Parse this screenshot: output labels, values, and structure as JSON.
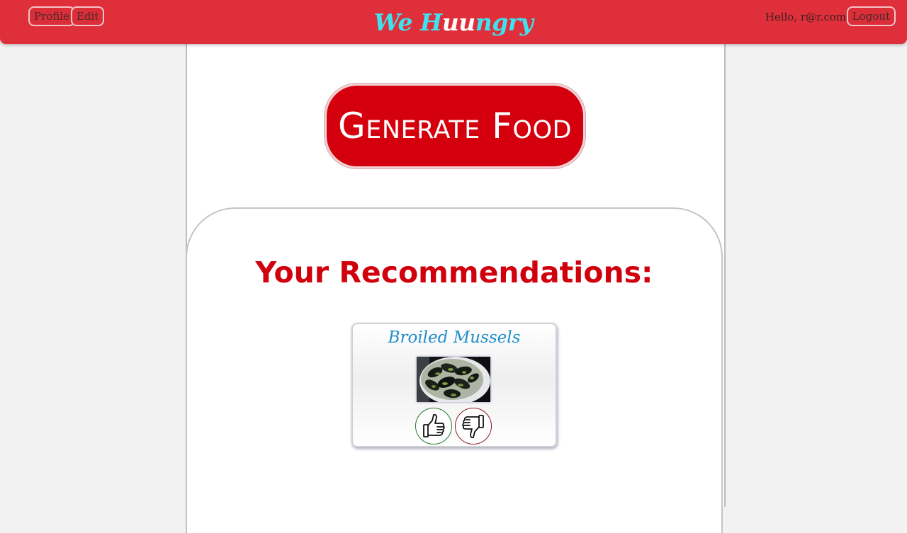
{
  "header": {
    "profile_label": "Profile",
    "edit_label": "Edit",
    "brand_part1": "We H",
    "brand_part2": "uu",
    "brand_part3": "ngry",
    "greeting": "Hello, r@r.com!",
    "logout_label": "Logout",
    "bar_color": "#de2f3a"
  },
  "main": {
    "generate_label": "Generate Food",
    "recommendations_title": "Your Recommendations:",
    "accent_color": "#d5000d"
  },
  "recommendations": [
    {
      "name": "Broiled Mussels",
      "image_icon": "mussels-photo",
      "like_icon": "thumbs-up-icon",
      "dislike_icon": "thumbs-down-icon"
    }
  ]
}
